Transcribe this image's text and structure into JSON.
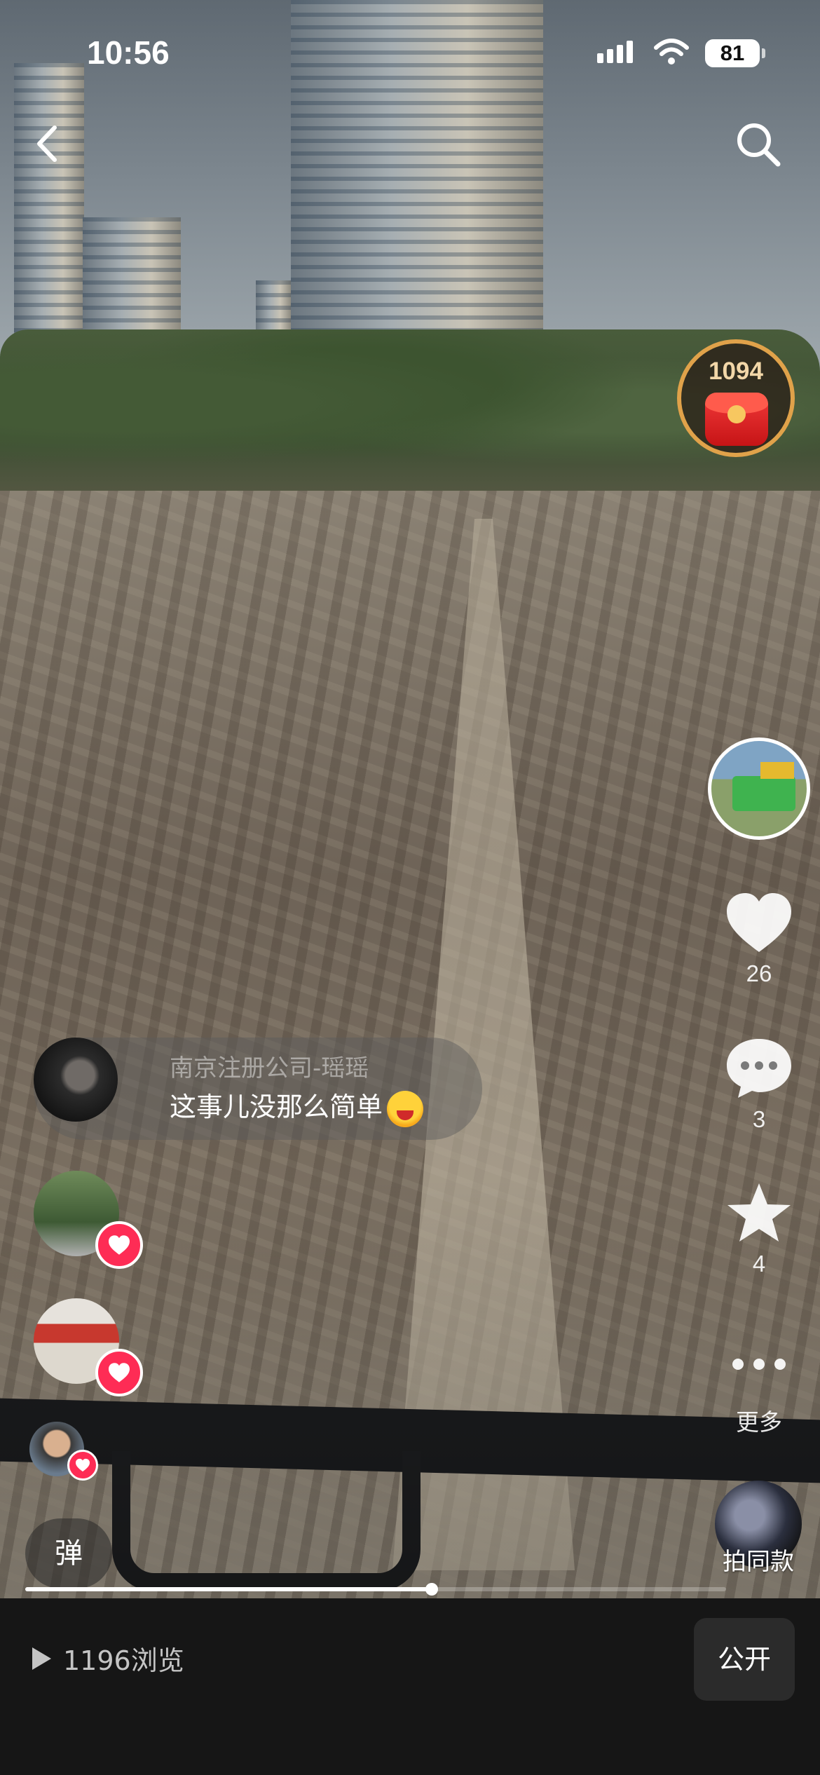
{
  "status_bar": {
    "time": "10:56",
    "battery": "81"
  },
  "red_packet": {
    "count": "1094"
  },
  "actions": {
    "likes": "26",
    "comments": "3",
    "favorites": "4",
    "more_label": "更多"
  },
  "live_comment": {
    "user": "南京注册公司-瑶瑶",
    "text": "这事儿没那么简单"
  },
  "danmaku_label": "弹",
  "same_style_label": "拍同款",
  "progress": {
    "fraction": 0.58
  },
  "bottom_bar": {
    "views": "1196浏览",
    "public_label": "公开"
  },
  "icons": [
    "back-icon",
    "search-icon",
    "heart-icon",
    "comment-icon",
    "star-icon",
    "more-icon",
    "play-icon",
    "signal-icon",
    "wifi-icon",
    "battery-icon"
  ],
  "colors": {
    "like_pink": "#fe2c55",
    "bottom_bg": "#161616",
    "packet_ring": "#e0a24a"
  }
}
